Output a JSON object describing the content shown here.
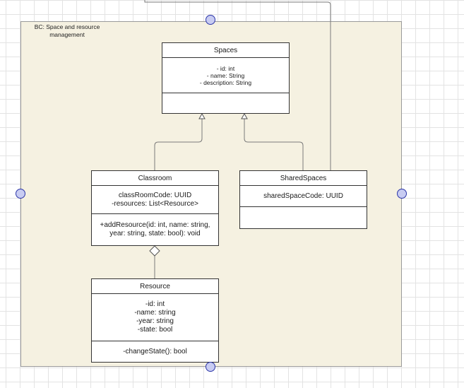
{
  "container": {
    "label": "BC: Space and resource management"
  },
  "classes": {
    "spaces": {
      "name": "Spaces",
      "attributes": [
        "- id: int",
        "- name: String",
        "- description: String"
      ],
      "operations": []
    },
    "classroom": {
      "name": "Classroom",
      "attributes": [
        "classRoomCode: UUID",
        "-resources: List<Resource>"
      ],
      "operations": [
        "+addResource(id: int, name: string,",
        "year: string, state: bool): void"
      ]
    },
    "shared_spaces": {
      "name": "SharedSpaces",
      "attributes": [
        "sharedSpaceCode: UUID"
      ],
      "operations": []
    },
    "resource": {
      "name": "Resource",
      "attributes": [
        "-id: int",
        "-name: string",
        "-year: string",
        "-state: bool"
      ],
      "operations": [
        "-changeState(): bool"
      ]
    }
  },
  "relationships": [
    {
      "type": "generalization",
      "from": "Classroom",
      "to": "Spaces"
    },
    {
      "type": "generalization",
      "from": "SharedSpaces",
      "to": "Spaces"
    },
    {
      "type": "aggregation",
      "whole": "Classroom",
      "part": "Resource"
    }
  ],
  "colors": {
    "container_fill": "#f5f1e1",
    "handle_fill": "#c8ccf2",
    "handle_stroke": "#2b35a8",
    "line": "#7a7a7a"
  }
}
